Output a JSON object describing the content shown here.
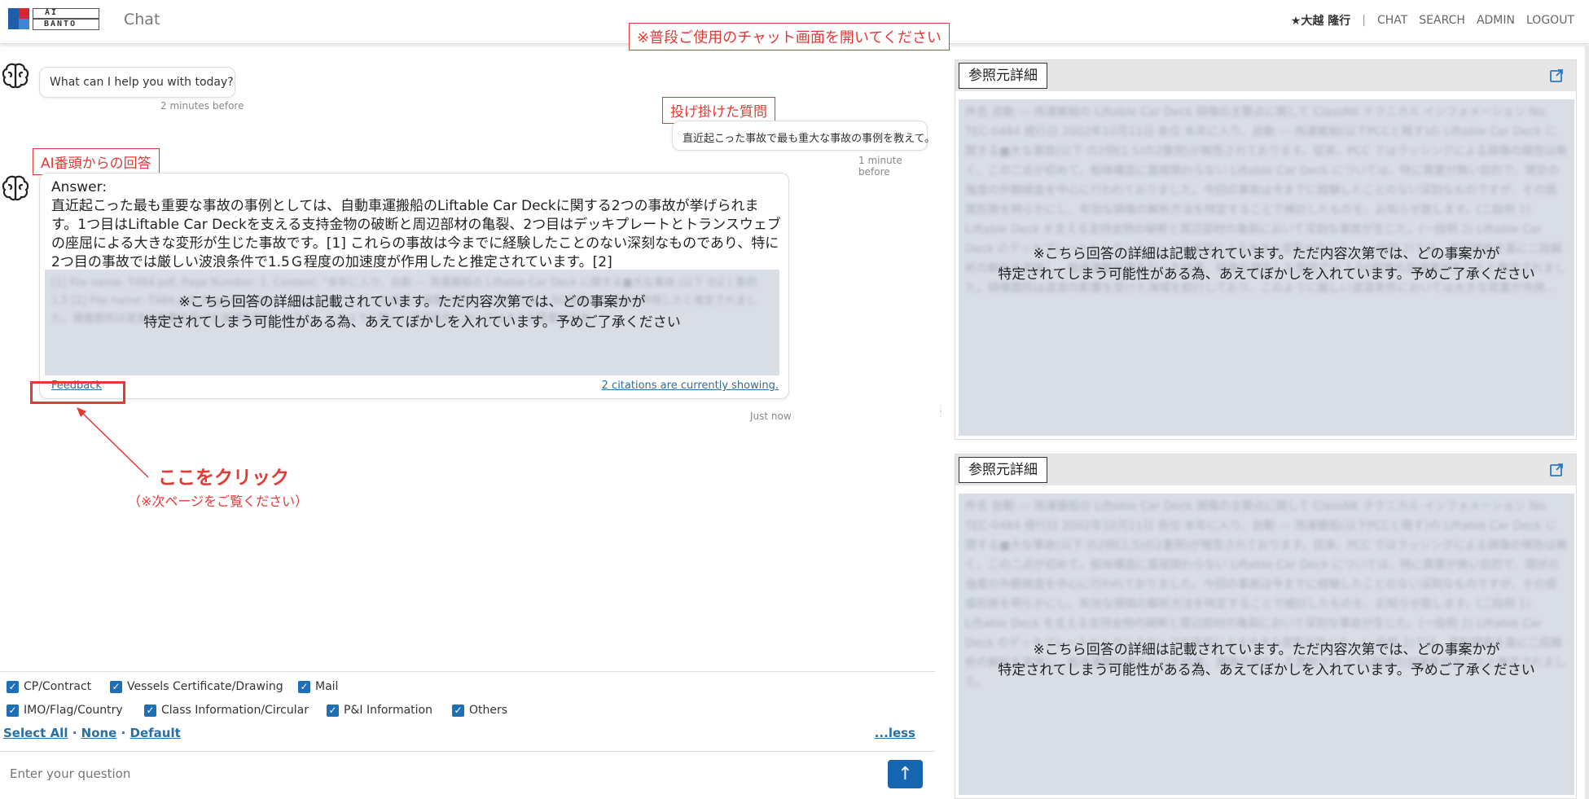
{
  "header": {
    "logo": {
      "line1": "AI",
      "line2": "BANTO"
    },
    "title": "Chat",
    "user": "★大越 隆行",
    "separator": "|",
    "nav": [
      "CHAT",
      "SEARCH",
      "ADMIN",
      "LOGOUT"
    ]
  },
  "annotations": {
    "top": "※普段ご使用のチャット画面を開いてください",
    "question_label": "投げ掛けた質問",
    "answer_label": "AI番頭からの回答",
    "click_here": "ここをクリック",
    "see_next": "（※次ページをご覧ください）"
  },
  "chat": {
    "greeting": "What can I help you with today?",
    "greeting_time": "2 minutes before",
    "question": "直近起こった事故で最も重大な事故の事例を教えて。",
    "question_time": "1 minute before",
    "answer_head": "Answer:",
    "answer_body": "直近起こった最も重要な事故の事例としては、自動車運搬船のLiftable Car Deckに関する2つの事故が挙げられます。1つ目はLiftable Car Deckを支える支持金物の破断と周辺部材の亀裂、2つ目はデッキプレートとトランスウェブの座屈による大きな変形が生じた事故です。[1] これらの事故は今までに経験したことのない深刻なものであり、特に2つ目の事故では厳しい波浪条件で1.5Ｇ程度の加速度が作用したと推定されています。[2]",
    "citation_blur": "[1] File name: T484.pdf, Page Number: 1, Content: \"本年に入り、自動 --- 用運搬船の Liftable Car Deck に関する■大な事故 (以下 の2 ) 事例 1,5 [2] File name: T484.pdf, Page Number: 1, Content: \"…行った結果、損傷の発生した箇所では 1.5G程度の加速度が作用したと推定されました。損傷箇所は波浪の影響を受けた海域を航行しており、このように厳しい波浪条件においては大きな荷重が作用…\"",
    "citation_notice": "※こちら回答の詳細は記載されています。ただ内容次第では、どの事案かが\n特定されてしまう可能性がある為、あえてぼかしを入れています。予めご了承ください",
    "feedback": "Feedback",
    "citations_showing": "2 citations are currently showing.",
    "answer_time": "Just now"
  },
  "filters": {
    "row1": [
      "CP/Contract",
      "Vessels Certificate/Drawing",
      "Mail"
    ],
    "row2": [
      "IMO/Flag/Country",
      "Class Information/Circular",
      "P&I Information",
      "Others"
    ],
    "select_all": "Select All",
    "dot": "·",
    "none": "None",
    "default": "Default",
    "less": "...less"
  },
  "input": {
    "placeholder": "Enter your question",
    "send_icon": "↑"
  },
  "panels": [
    {
      "title": "参照元詳細",
      "blur": "件名 自動 --- 用運搬船の Liftable Car Deck 損傷の主要点に関して ClassNK テクニカル インフォメーション No. TEC-0484 発行日 2002年10月11日 各位 本年に入り、自動 --- 用運搬船(以下PCCと略す)の Liftable Car Deck に関する■大な事故(以下 の2例(1,5)の2重例)が報告されております。従来、PCC ではラッシングによる損傷の報告は無く、この二点が初めて。船体構造に直接関わらない Liftable Car Deck については、特に需要が無い目的で、現状の強度の外観検査を中心に行われておりました。今回の事故は今までに経験したことのない深刻なものですが、その損傷形態を明らかにし、有効な損傷の解析方法を特定することで検討したものを、お知らせ致します。(二段例 1) Liftable Deck を支える支持金物の破断と周辺部材の亀裂において深刻な事故が生じた。(一段例 2) Liftable Car Deck のデッキプレートとトランスウェブの座屈による大きな変形が生じた。(=段例 2)では、実船調査を基に二段解析の解析を実施し、船体運動計算を行った結果、損傷の発生した箇所では 1.5G程度の加速度が生じたと推定されました。損傷箇所は波浪の影響を受けた海域を航行しており、このように厳しい波浪条件においては大きな荷重が作用…",
      "notice": "※こちら回答の詳細は記載されています。ただ内容次第では、どの事案かが\n特定されてしまう可能性がある為、あえてぼかしを入れています。予めご了承ください"
    },
    {
      "title": "参照元詳細",
      "blur": "件名 自動 --- 用運搬船の Liftable Car Deck 損傷の主要点に関して ClassNK テクニカル インフォメーション No. TEC-0484 発行日 2002年10月11日 各位 本年に入り、自動 --- 用運搬船(以下PCCと略す)の Liftable Car Deck に関する■大な事故(以下 の2例(1,5)の2重例)が報告されております。従来、PCC ではラッシングによる損傷の報告は無く、この二点が初めて。船体構造に直接関わらない Liftable Car Deck については、特に需要が無い目的で、現状の強度の外観検査を中心に行われておりました。今回の事故は今までに経験したことのない深刻なものですが、その損傷形態を明らかにし、有効な損傷の解析方法を特定することで検討したものを、お知らせ致します。(二段例 1) Liftable Deck を支える支持金物の破断と周辺部材の亀裂において深刻な事故が生じた。(一段例 2) Liftable Car Deck のデッキプレートとトランスウェブの座屈による大きな変形が生じた。(=段例 2)では、実船調査を基に二段解析の解析を実施し、船体運動計算を行った結果、損傷の発生した箇所では 1.5G程度の加速度が生じたと推定されました。",
      "notice": "※こちら回答の詳細は記載されています。ただ内容次第では、どの事案かが\n特定されてしまう可能性がある為、あえてぼかしを入れています。予めご了承ください"
    }
  ],
  "colors": {
    "accent": "#1565b0",
    "annotation": "#e53935",
    "blur_bg": "#d9dde6",
    "logo_blue": "#1f5fa8",
    "logo_red": "#d7262f"
  }
}
